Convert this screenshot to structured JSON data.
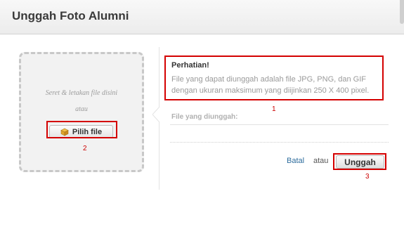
{
  "dialog": {
    "title": "Unggah Foto Alumni"
  },
  "dropzone": {
    "hint_line1": "Seret & letakan file disini",
    "hint_line2": "atau",
    "pick_button_label": "Pilih file",
    "pick_button_icon": "package-icon"
  },
  "notice": {
    "title": "Perhatian!",
    "line1": "File yang dapat diunggah adalah file JPG, PNG, dan GIF",
    "line2": "dengan ukuran maksimum yang diijinkan 250 X 400 pixel."
  },
  "uploaded": {
    "label": "File yang diunggah:"
  },
  "actions": {
    "cancel_label": "Batal",
    "or_label": "atau",
    "upload_label": "Unggah"
  },
  "annotations": {
    "n1": "1",
    "n2": "2",
    "n3": "3",
    "color": "#d40000"
  }
}
